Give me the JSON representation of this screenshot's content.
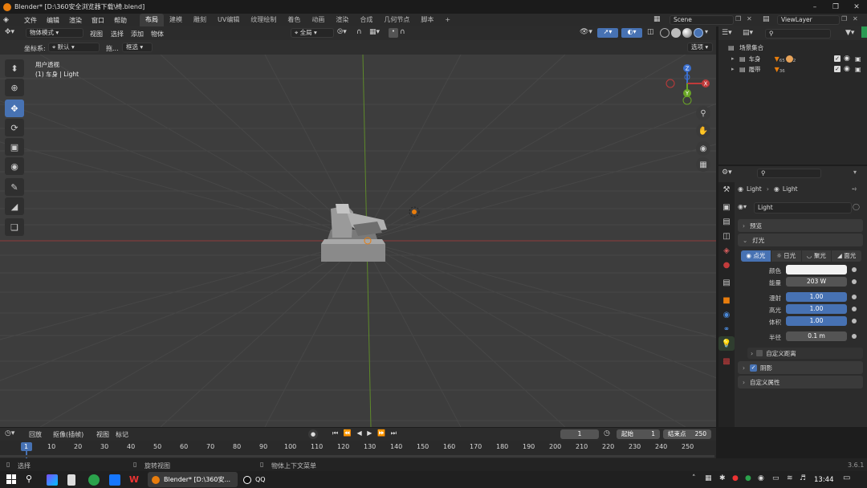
{
  "window": {
    "title": "Blender* [D:\\360安全浏览器下载\\椅.blend]"
  },
  "menu": {
    "items": [
      "文件",
      "编辑",
      "渲染",
      "窗口",
      "帮助"
    ]
  },
  "workspaces": {
    "tabs": [
      "布局",
      "建模",
      "雕刻",
      "UV编辑",
      "纹理绘制",
      "着色",
      "动画",
      "渲染",
      "合成",
      "几何节点",
      "脚本"
    ],
    "active": "布局",
    "add": "+"
  },
  "scene": {
    "name": "Scene",
    "view_layer": "ViewLayer"
  },
  "viewport": {
    "header": {
      "mode": "物体模式",
      "menus": [
        "视图",
        "选择",
        "添加",
        "物体"
      ],
      "transform_orientation": "全局"
    },
    "tool_settings": {
      "orientation_label": "坐标系:",
      "orientation_value": "默认",
      "drag_label": "拖...",
      "drag_value": "框选",
      "options": "选项"
    },
    "overlay": {
      "view_name": "用户透视",
      "object_info": "(1) 车身 | Light"
    },
    "gizmo": {
      "z": "Z",
      "x": "X",
      "y": "Y"
    }
  },
  "outliner": {
    "title": "场景集合",
    "items": [
      {
        "name": "车身",
        "count": "65",
        "children_count": "2"
      },
      {
        "name": "履带",
        "count": "36"
      }
    ]
  },
  "properties": {
    "breadcrumb": [
      "Light",
      "Light"
    ],
    "data_name": "Light",
    "sections": {
      "preview": "预览",
      "light": "灯光",
      "shadow": "阴影",
      "custom_props": "自定义属性",
      "custom_distance": "自定义距离"
    },
    "light_types": [
      "点光",
      "日光",
      "聚光",
      "面光"
    ],
    "active_light_type": "点光",
    "fields": {
      "color_label": "颜色",
      "color_value": "#f2f2f2",
      "power_label": "能量",
      "power_value": "203 W",
      "diffuse_label": "漫射",
      "diffuse_value": "1.00",
      "specular_label": "高光",
      "specular_value": "1.00",
      "volume_label": "体积",
      "volume_value": "1.00",
      "radius_label": "半径",
      "radius_value": "0.1 m"
    },
    "shadow_checked": true,
    "custom_distance_checked": false
  },
  "timeline": {
    "menus": [
      "回放",
      "抠像(插帧)",
      "视图",
      "标记"
    ],
    "current_frame": "1",
    "start_label": "起始",
    "start_value": "1",
    "end_label": "结束点",
    "end_value": "250",
    "ruler": [
      "1",
      "10",
      "20",
      "30",
      "40",
      "50",
      "60",
      "70",
      "80",
      "90",
      "100",
      "110",
      "120",
      "130",
      "140",
      "150",
      "160",
      "170",
      "180",
      "190",
      "200",
      "210",
      "220",
      "230",
      "240",
      "250"
    ]
  },
  "statusbar": {
    "select": "选择",
    "rotate": "旋转视图",
    "context": "物体上下文菜单",
    "version": "3.6.1"
  },
  "taskbar": {
    "apps": [
      {
        "label": "Blender* [D:\\360安..."
      },
      {
        "label": "QQ"
      }
    ],
    "time": "13:44"
  },
  "colors": {
    "accent": "#4772b3",
    "x_axis": "#b43a3a",
    "y_axis": "#6aa626",
    "blender_orange": "#e87d0d"
  }
}
